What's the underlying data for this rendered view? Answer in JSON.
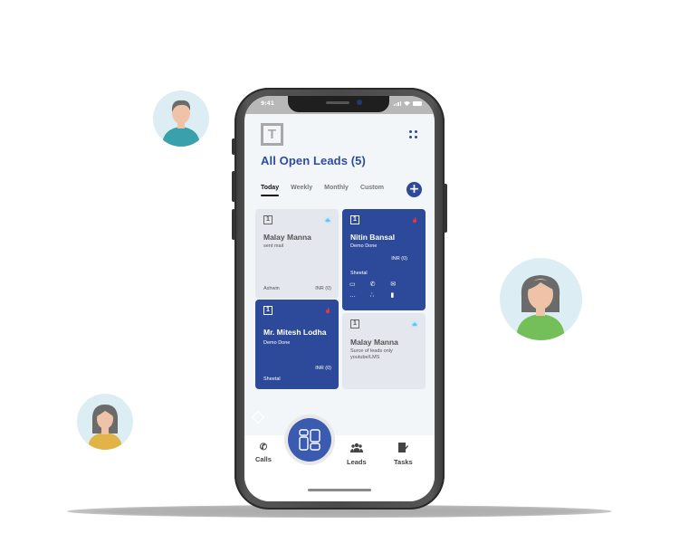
{
  "status_bar": {
    "time": "9:41"
  },
  "header": {
    "logo_letter": "T",
    "title": "All Open Leads (5)"
  },
  "tabs": [
    {
      "label": "Today",
      "active": true
    },
    {
      "label": "Weekly",
      "active": false
    },
    {
      "label": "Monthly",
      "active": false
    },
    {
      "label": "Custom",
      "active": false
    }
  ],
  "add_button": {
    "label": "+"
  },
  "leads": [
    {
      "index": "1",
      "name": "Malay Manna",
      "status": "sent mail",
      "owner": "Ashwin",
      "amount": "INR (0)",
      "tag": "cloud-icon",
      "style": "light"
    },
    {
      "index": "1",
      "name": "Nitin Bansal",
      "status": "Demo Done",
      "owner": "Sheetal",
      "amount": "INR (0)",
      "tag": "fire-icon",
      "style": "dark",
      "actions": [
        "message",
        "call",
        "email",
        "assign",
        "group",
        "copy"
      ]
    },
    {
      "index": "1",
      "name": "Mr. Mitesh Lodha",
      "status": "Demo Done",
      "owner": "Sheetal",
      "amount": "INR (0)",
      "tag": "fire-icon",
      "style": "dark"
    },
    {
      "index": "1",
      "name": "Malay Manna",
      "status": "Surce of leads only youtube/LMS",
      "tag": "cloud-icon",
      "style": "light"
    }
  ],
  "bottom_nav": [
    {
      "label": "Calls",
      "icon": "phone-icon"
    },
    {
      "label": "Leads",
      "icon": "users-icon"
    },
    {
      "label": "Tasks",
      "icon": "tasks-icon"
    }
  ],
  "colors": {
    "primary": "#2d4a9a",
    "card_light": "#e4e7ee",
    "fire": "#e53935",
    "cloud": "#6fc3e8",
    "avatar_bg": "#dceef3"
  }
}
